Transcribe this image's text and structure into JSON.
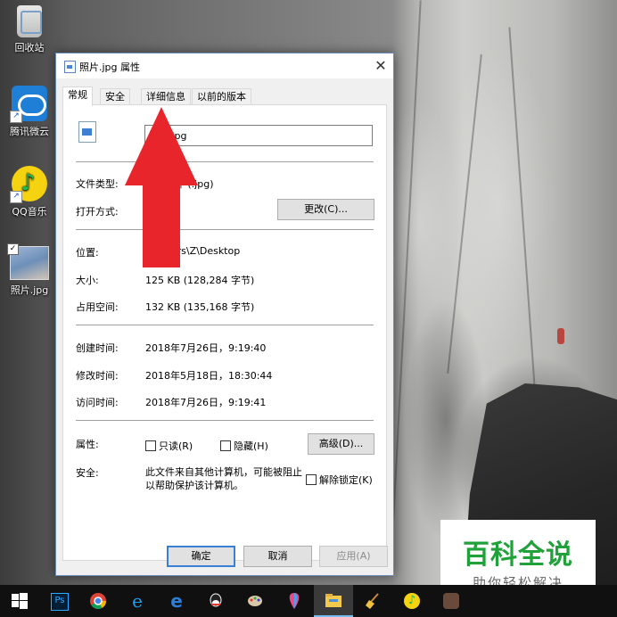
{
  "desktop": {
    "icons": [
      {
        "label": "回收站"
      },
      {
        "label": "腾讯微云"
      },
      {
        "label": "QQ音乐"
      },
      {
        "label": "照片.jpg"
      }
    ]
  },
  "dialog": {
    "title": "照片.jpg 属性",
    "close_glyph": "✕",
    "tabs": [
      "常规",
      "安全",
      "详细信息",
      "以前的版本"
    ],
    "active_tab": "常规",
    "filename_value": "照片.jpg",
    "file_type_label": "文件类型:",
    "file_type_value": "JPG 文件 (.jpg)",
    "open_with_label": "打开方式:",
    "change_button": "更改(C)...",
    "location_label": "位置:",
    "location_value": "C:\\Users\\Z\\Desktop",
    "size_label": "大小:",
    "size_value": "125 KB (128,284 字节)",
    "disk_size_label": "占用空间:",
    "disk_size_value": "132 KB (135,168 字节)",
    "created_label": "创建时间:",
    "created_value": "2018年7月26日，9:19:40",
    "modified_label": "修改时间:",
    "modified_value": "2018年5月18日，18:30:44",
    "accessed_label": "访问时间:",
    "accessed_value": "2018年7月26日，9:19:41",
    "attributes_label": "属性:",
    "readonly_label": "只读(R)",
    "hidden_label": "隐藏(H)",
    "advanced_button": "高级(D)...",
    "security_label": "安全:",
    "security_text": "此文件来自其他计算机，可能被阻止以帮助保护该计算机。",
    "unblock_label": "解除锁定(K)",
    "ok_button": "确定",
    "cancel_button": "取消",
    "apply_button": "应用(A)"
  },
  "watermark": {
    "title": "百科全说",
    "subtitle": "助你轻松解决"
  },
  "taskbar": {
    "apps": [
      "start-icon",
      "photoshop-icon",
      "chrome-icon",
      "ie-icon",
      "edge-icon",
      "qq-icon",
      "paint-icon",
      "balloon-icon",
      "file-explorer-icon",
      "broom-icon",
      "qqmusic-icon",
      "game-icon"
    ],
    "ps_text": "Ps"
  },
  "colors": {
    "accent": "#3a7fd6",
    "arrow": "#e8252b",
    "watermark_green": "#21a13a"
  }
}
